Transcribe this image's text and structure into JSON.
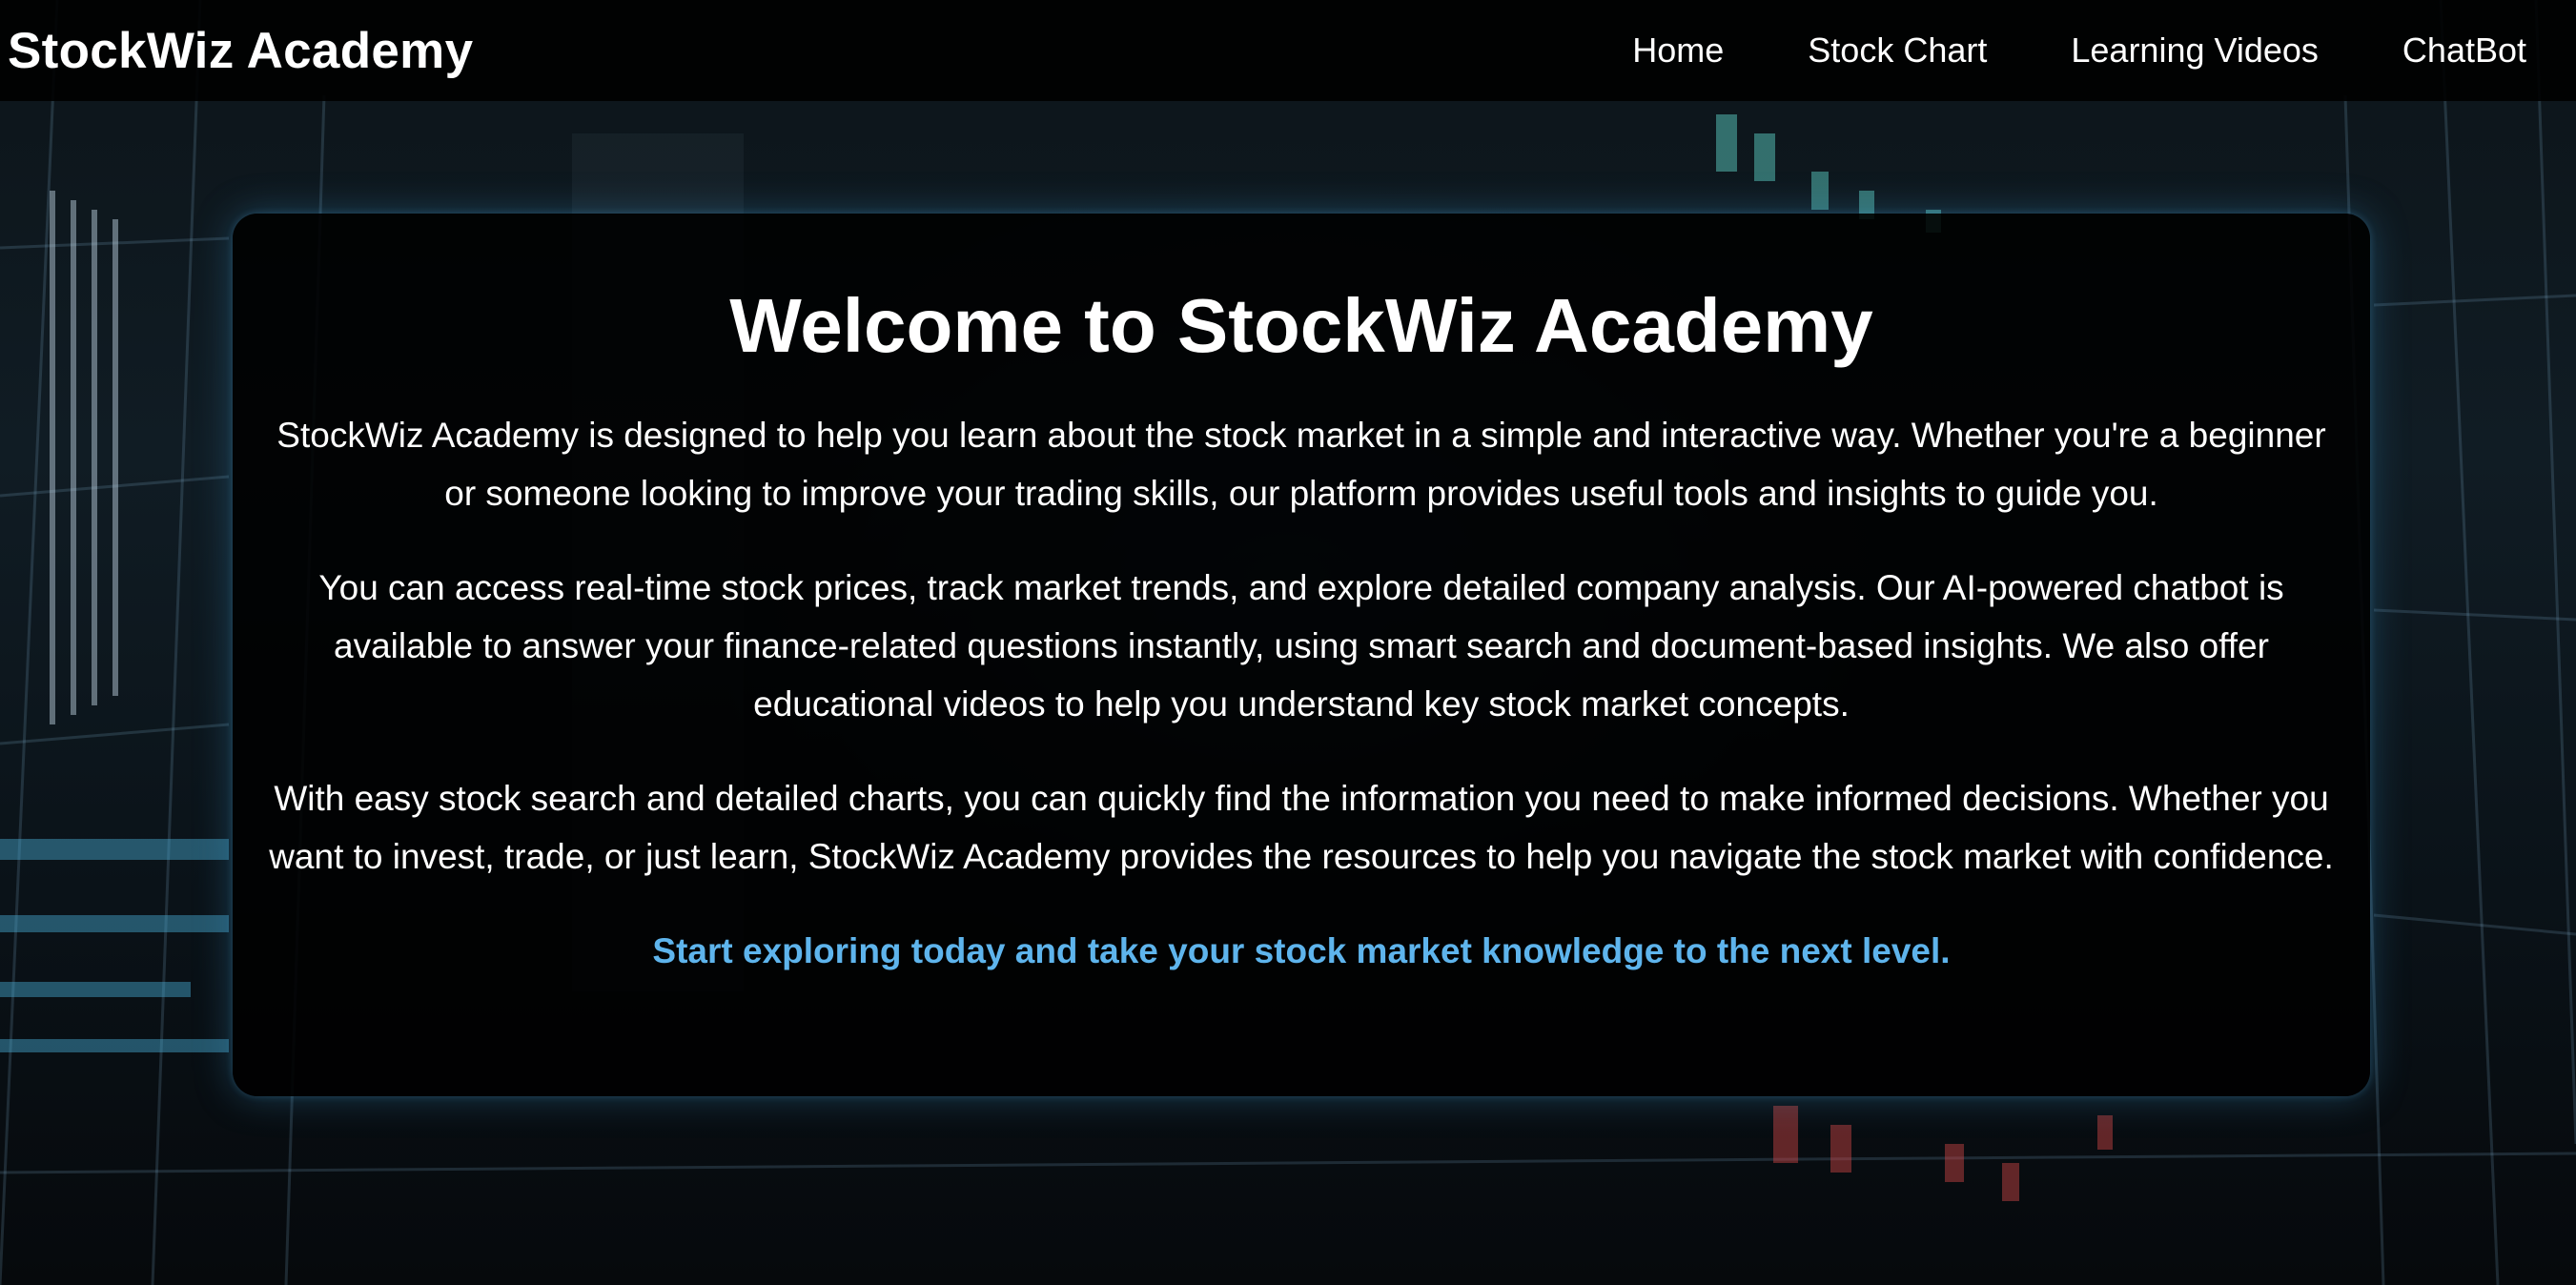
{
  "navbar": {
    "brand": "StockWiz Academy",
    "links": [
      {
        "label": "Home"
      },
      {
        "label": "Stock Chart"
      },
      {
        "label": "Learning Videos"
      },
      {
        "label": "ChatBot"
      }
    ]
  },
  "main": {
    "title": "Welcome to StockWiz Academy",
    "paragraphs": [
      "StockWiz Academy is designed to help you learn about the stock market in a simple and interactive way. Whether you're a beginner or someone looking to improve your trading skills, our platform provides useful tools and insights to guide you.",
      "You can access real-time stock prices, track market trends, and explore detailed company analysis. Our AI-powered chatbot is available to answer your finance-related questions instantly, using smart search and document-based insights. We also offer educational videos to help you understand key stock market concepts.",
      "With easy stock search and detailed charts, you can quickly find the information you need to make informed decisions. Whether you want to invest, trade, or just learn, StockWiz Academy provides the resources to help you navigate the stock market with confidence."
    ],
    "cta": "Start exploring today and take your stock market knowledge to the next level."
  },
  "colors": {
    "accent": "#5eb4ec",
    "navbar_bg": "#000000",
    "card_bg": "#000000",
    "text": "#ffffff"
  }
}
